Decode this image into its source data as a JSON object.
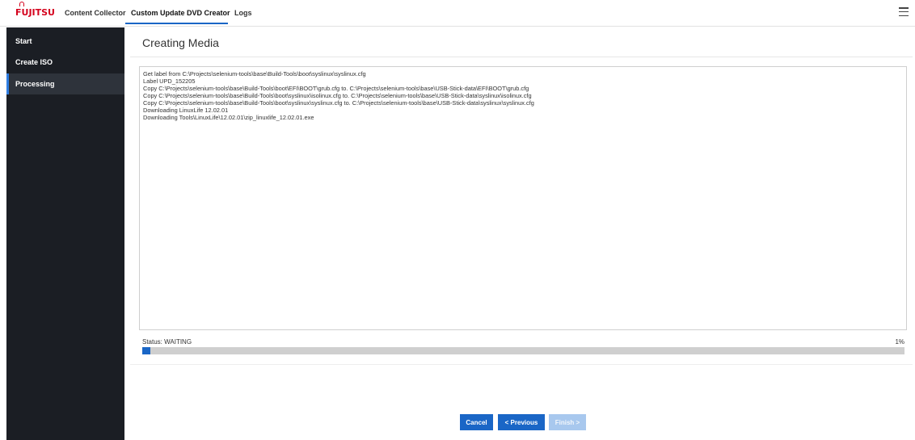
{
  "header": {
    "logo_text": "FUJITSU",
    "tabs": [
      {
        "label": "Content Collector"
      },
      {
        "label": "Custom Update DVD Creator"
      },
      {
        "label": "Logs"
      }
    ],
    "active_tab": "Custom Update DVD Creator",
    "menu_icon": "hamburger-icon",
    "brand_color": "#d4021d",
    "accent_color": "#1a66c6"
  },
  "sidebar": {
    "items": [
      {
        "label": "Start"
      },
      {
        "label": "Create ISO"
      },
      {
        "label": "Processing"
      }
    ],
    "active_item": "Processing"
  },
  "main": {
    "title": "Creating Media",
    "log_lines": [
      "Get label from C:\\Projects\\selenium-tools\\base\\Build-Tools\\boot\\syslinux\\syslinux.cfg",
      "Label UPD_152205",
      "Copy C:\\Projects\\selenium-tools\\base\\Build-Tools\\boot\\EFI\\BOOT\\grub.cfg to. C:\\Projects\\selenium-tools\\base\\USB-Stick-data\\EFI\\BOOT\\grub.cfg",
      "Copy C:\\Projects\\selenium-tools\\base\\Build-Tools\\boot\\syslinux\\isolinux.cfg to. C:\\Projects\\selenium-tools\\base\\USB-Stick-data\\syslinux\\isolinux.cfg",
      "Copy C:\\Projects\\selenium-tools\\base\\Build-Tools\\boot\\syslinux\\syslinux.cfg to. C:\\Projects\\selenium-tools\\base\\USB-Stick-data\\syslinux\\syslinux.cfg",
      "Downloading LinuxLife 12.02.01",
      "Downloading Tools\\LinuxLife\\12.02.01\\zip_linuxlife_12.02.01.exe"
    ],
    "status_text": "Status: WAITING",
    "progress_label": "1%",
    "progress_fraction": 0.01
  },
  "footer": {
    "cancel_label": "Cancel",
    "previous_label": "< Previous",
    "finish_label": "Finish >"
  }
}
